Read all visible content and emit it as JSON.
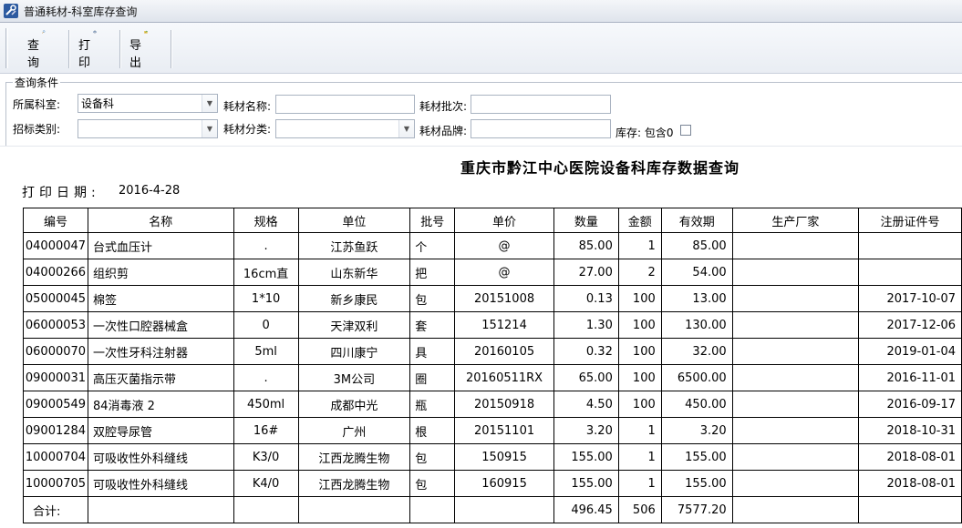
{
  "window": {
    "title": "普通耗材-科室库存查询"
  },
  "toolbar": {
    "buttons": [
      {
        "label": "查 询",
        "icon": "search-icon"
      },
      {
        "label": "打 印",
        "icon": "printer-icon"
      },
      {
        "label": "导 出",
        "icon": "export-icon"
      }
    ]
  },
  "query": {
    "group_title": "查询条件",
    "dept_label": "所属科室:",
    "dept_value": "设备科",
    "name_label": "耗材名称:",
    "name_value": "",
    "batch_label": "耗材批次:",
    "batch_value": "",
    "bid_label": "招标类别:",
    "bid_value": "",
    "category_label": "耗材分类:",
    "category_value": "",
    "brand_label": "耗材品牌:",
    "brand_value": "",
    "stock_label": "库存: 包含0",
    "stock_checked": false
  },
  "report": {
    "title": "重庆市黔江中心医院设备科库存数据查询",
    "print_date_label": "打印日期:",
    "print_date": "2016-4-28",
    "columns": [
      "编号",
      "名称",
      "规格",
      "单位",
      "批号",
      "单价",
      "数量",
      "金额",
      "有效期",
      "生产厂家",
      "注册证件号"
    ],
    "rows": [
      [
        "04000047",
        "台式血压计",
        ".",
        "江苏鱼跃",
        "个",
        "@",
        "85.00",
        "1",
        "85.00",
        "",
        ""
      ],
      [
        "04000266",
        "组织剪",
        "16cm直",
        "山东新华",
        "把",
        "@",
        "27.00",
        "2",
        "54.00",
        "",
        ""
      ],
      [
        "05000045",
        "棉签",
        "1*10",
        "新乡康民",
        "包",
        "20151008",
        "0.13",
        "100",
        "13.00",
        "",
        "2017-10-07"
      ],
      [
        "06000053",
        "一次性口腔器械盒",
        "0",
        "天津双利",
        "套",
        "151214",
        "1.30",
        "100",
        "130.00",
        "",
        "2017-12-06"
      ],
      [
        "06000070",
        "一次性牙科注射器",
        "5ml",
        "四川康宁",
        "具",
        "20160105",
        "0.32",
        "100",
        "32.00",
        "",
        "2019-01-04"
      ],
      [
        "09000031",
        "高压灭菌指示带",
        ".",
        "3M公司",
        "圈",
        "20160511RX",
        "65.00",
        "100",
        "6500.00",
        "",
        "2016-11-01"
      ],
      [
        "09000549",
        "84消毒液 2",
        "450ml",
        "成都中光",
        "瓶",
        "20150918",
        "4.50",
        "100",
        "450.00",
        "",
        "2016-09-17"
      ],
      [
        "09001284",
        "双腔导尿管",
        "16#",
        "广州",
        "根",
        "20151101",
        "3.20",
        "1",
        "3.20",
        "",
        "2018-10-31"
      ],
      [
        "10000704",
        "可吸收性外科缝线",
        "K3/0",
        "江西龙腾生物",
        "包",
        "150915",
        "155.00",
        "1",
        "155.00",
        "",
        "2018-08-01"
      ],
      [
        "10000705",
        "可吸收性外科缝线",
        "K4/0",
        "江西龙腾生物",
        "包",
        "160915",
        "155.00",
        "1",
        "155.00",
        "",
        "2018-08-01"
      ]
    ],
    "total": {
      "label": "合计:",
      "price": "496.45",
      "qty": "506",
      "amount": "7577.20"
    }
  }
}
